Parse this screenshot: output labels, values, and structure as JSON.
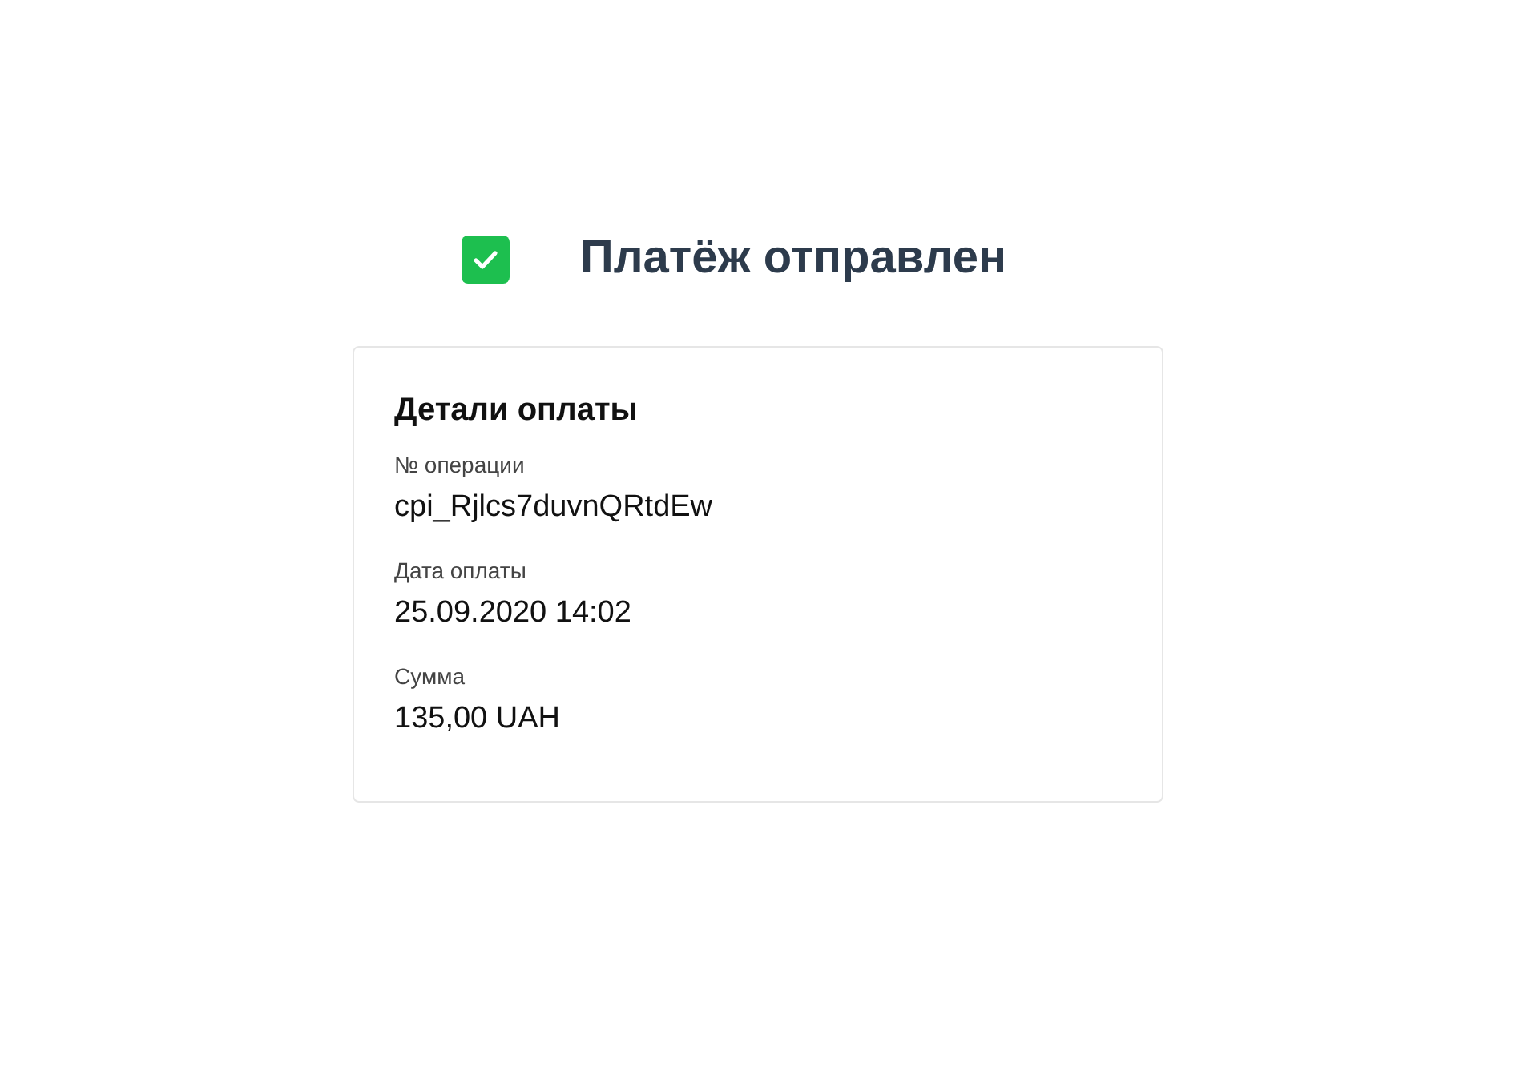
{
  "status": {
    "title": "Платёж отправлен"
  },
  "details": {
    "heading": "Детали оплаты",
    "fields": [
      {
        "label": "№ операции",
        "value": "cpi_Rjlcs7duvnQRtdEw"
      },
      {
        "label": "Дата оплаты",
        "value": "25.09.2020 14:02"
      },
      {
        "label": "Сумма",
        "value": "135,00 UAH"
      }
    ]
  }
}
